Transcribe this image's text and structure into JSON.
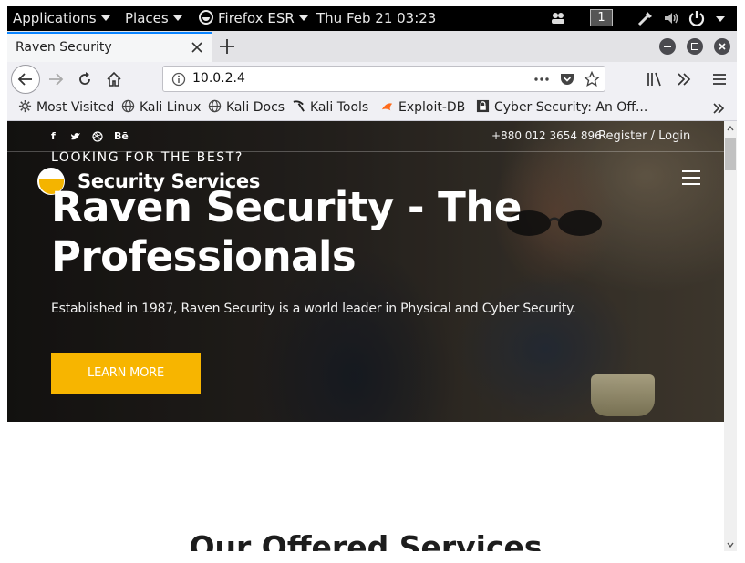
{
  "system_bar": {
    "applications": "Applications",
    "places": "Places",
    "firefox": "Firefox ESR",
    "datetime": "Thu Feb 21  03:23",
    "workspace": "1"
  },
  "browser": {
    "tab_title": "Raven Security",
    "url": "10.0.2.4",
    "bookmarks": [
      "Most Visited",
      "Kali Linux",
      "Kali Docs",
      "Kali Tools",
      "Exploit-DB",
      "Cyber Security: An Off..."
    ]
  },
  "site": {
    "phone": "+880 012 3654 896",
    "login": "Register / Login",
    "logo_text": "Security Services",
    "kicker": "LOOKING FOR THE BEST?",
    "headline_line1": "Raven Security - The",
    "headline_line2": "Professionals",
    "subtext": "Established in 1987, Raven Security is a world leader in Physical and Cyber Security.",
    "cta_label": "LEARN MORE",
    "section_title": "Our Offered Services",
    "social_facebook": "f",
    "social_behance": "Bē",
    "accent_color": "#f7b500"
  },
  "icons": [
    "chevron-down-icon",
    "power-icon",
    "volume-icon",
    "network-icon",
    "people-icon",
    "back-icon",
    "forward-icon",
    "reload-icon",
    "home-icon",
    "info-icon",
    "more-icon",
    "pocket-icon",
    "star-icon",
    "library-icon",
    "overflow-icon",
    "menu-icon",
    "gear-icon",
    "globe-icon",
    "pick-icon",
    "exploit-icon",
    "lock-icon",
    "close-icon",
    "plus-icon",
    "minimize-icon",
    "maximize-icon",
    "twitter-icon",
    "dribbble-icon"
  ]
}
